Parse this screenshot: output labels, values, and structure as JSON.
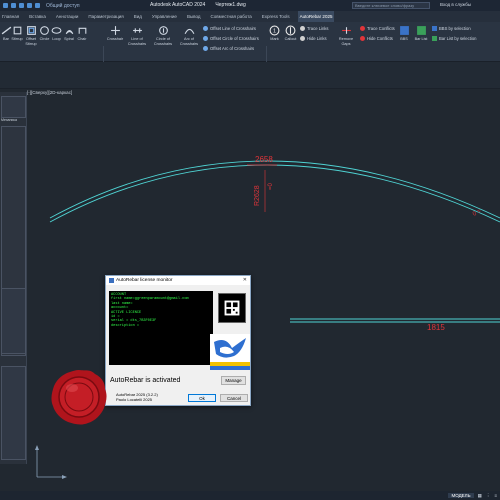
{
  "titlebar": {
    "share_label": "Общий доступ",
    "app_title": "Autodesk AutoCAD 2024",
    "file_name": "Чертеж1.dwg",
    "search_placeholder": "Введите ключевое слово/фразу",
    "login_label": "Вход в службы"
  },
  "tabs": [
    "Главная",
    "Вставка",
    "Аннотации",
    "Параметризация",
    "Вид",
    "Управление",
    "Вывод",
    "Совместная работа",
    "Express Tools",
    "AutoRebar 2025"
  ],
  "active_tab": "AutoRebar 2025",
  "ribbon": {
    "rebars_buttons": [
      "Bar",
      "Stirrup",
      "Offset Stirrup",
      "Circle",
      "Loop",
      "Spiral",
      "Chair"
    ],
    "crosshair_buttons": [
      "Crosshair",
      "Line of Crosshairs",
      "Circle of Crosshairs",
      "Arc of Crosshairs"
    ],
    "crosshair_small": [
      "Offset Line of Crosshairs",
      "Offset Circle of Crosshairs",
      "Offset Arc of Crosshairs"
    ],
    "scheduling_buttons": [
      "Mark",
      "Callout"
    ],
    "scheduling_small": [
      "Trace Links",
      "Hide Links",
      "Trace Conflicts",
      "Hide Conflicts"
    ],
    "remove_gaps": "Remove Gaps",
    "bbs": "BBS",
    "bar_list": "Bar List",
    "bbs_sel": "BBS by selection",
    "barlist_sel": "Bar List by selection",
    "panel_rebars": "Rebars",
    "panel_crosshairs": "Crosshairs",
    "panel_scheduling": "Scheduling",
    "mark_number": "1"
  },
  "viewport_label": "[-][Сверху][2D-каркас]",
  "left_panel_text": "Механика",
  "drawing": {
    "dim_top": "2658",
    "dim_vertical": "R2628",
    "dim_vertical_extra": "=0",
    "dim_right": "0 =",
    "dim_bottom": "1815"
  },
  "dialog": {
    "title": "AutoRebar license monitor",
    "console_lines": [
      "ACCOUNT",
      "first name=ggreenparamount@gmail.com",
      "last name=",
      "account=",
      "",
      "ACTIVE LICENCE",
      "id =",
      "serial = dts_7B3F0E3F",
      "description ="
    ],
    "activated_text": "AutoRebar is activated",
    "manage_label": "Manage",
    "version_line1": "AutoRebar 2025 (3.2.2)",
    "version_line2": "Paolo Locatelli 2025",
    "ok_label": "Ok",
    "cancel_label": "Cancel"
  },
  "statusbar": {
    "model_label": "МОДЕЛЬ"
  },
  "colors": {
    "canvas": "#212830",
    "arc": "#4fd3d3",
    "dimension": "#e0353a"
  }
}
